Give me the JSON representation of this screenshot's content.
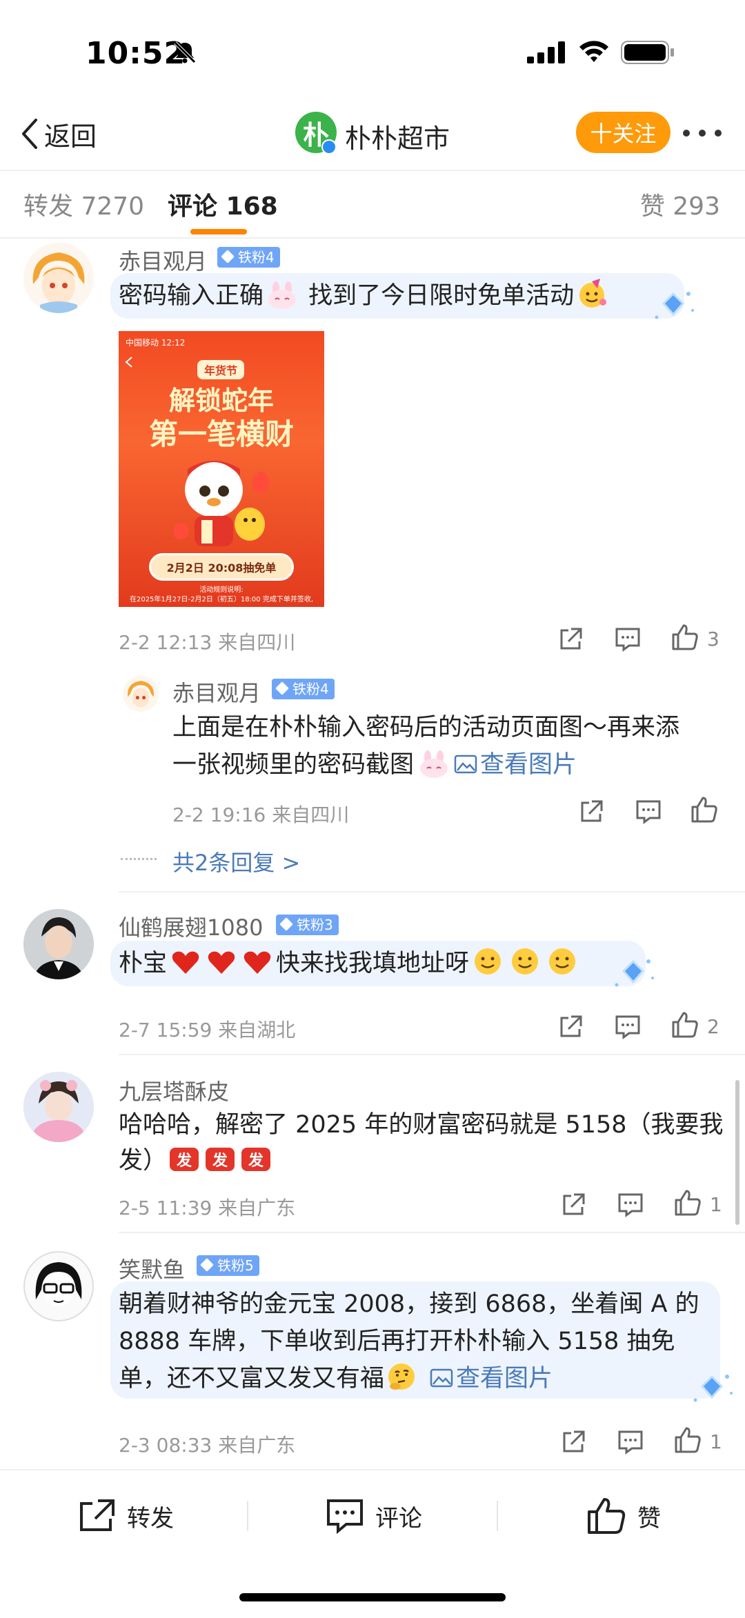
{
  "status": {
    "time": "10:52"
  },
  "nav": {
    "back_label": "返回",
    "logo_char": "朴",
    "title": "朴朴超市",
    "follow_label": "十关注"
  },
  "tabs": {
    "forward": "转发 7270",
    "comment": "评论 168",
    "like": "赞 293"
  },
  "comments": [
    {
      "user": "赤目观月",
      "badge": "铁粉4",
      "text_a": "密码输入正确",
      "text_b": " 找到了今日限时免单活动",
      "meta": "2-2 12:13  来自四川",
      "likes": "3",
      "image": {
        "status": "中国移动 12:12",
        "tag": "年货节",
        "title1": "解锁蛇年",
        "title2": "第一笔横财",
        "pill": "2月2日 20:08抽免单",
        "rules_title": "活动规则说明:",
        "rules": "在2025年1月27日-2月2日（初五）18:00 完成下单并签收,"
      },
      "reply": {
        "user": "赤目观月",
        "badge": "铁粉4",
        "line1": "上面是在朴朴输入密码后的活动页面图～再来添",
        "line2": "一张视频里的密码截图",
        "link": "查看图片",
        "meta": "2-2 19:16  来自四川"
      },
      "more_replies": "共2条回复 >"
    },
    {
      "user": "仙鹤展翅1080",
      "badge": "铁粉3",
      "text_a": "朴宝",
      "text_b": "快来找我填地址呀",
      "meta": "2-7 15:59  来自湖北",
      "likes": "2"
    },
    {
      "user": "九层塔酥皮",
      "line1": "哈哈哈，解密了 2025 年的财富密码就是 5158（我要我",
      "line2": "发）",
      "meta": "2-5 11:39  来自广东",
      "likes": "1"
    },
    {
      "user": "笑默鱼",
      "badge": "铁粉5",
      "line1": "朝着财神爷的金元宝 2008，接到 6868，坐着闽 A 的",
      "line2": "8888 车牌，下单收到后再打开朴朴输入 5158 抽免",
      "line3": "单，还不又富又发又有福",
      "link": "查看图片",
      "meta": "2-3 08:33  来自广东",
      "likes": "1"
    }
  ],
  "bottom": {
    "forward": "转发",
    "comment": "评论",
    "like": "赞"
  },
  "colors": {
    "accent": "#ff8200",
    "follow": "#ff9a0a",
    "link": "#4a7ab8",
    "badge": "#6fa5f7"
  }
}
